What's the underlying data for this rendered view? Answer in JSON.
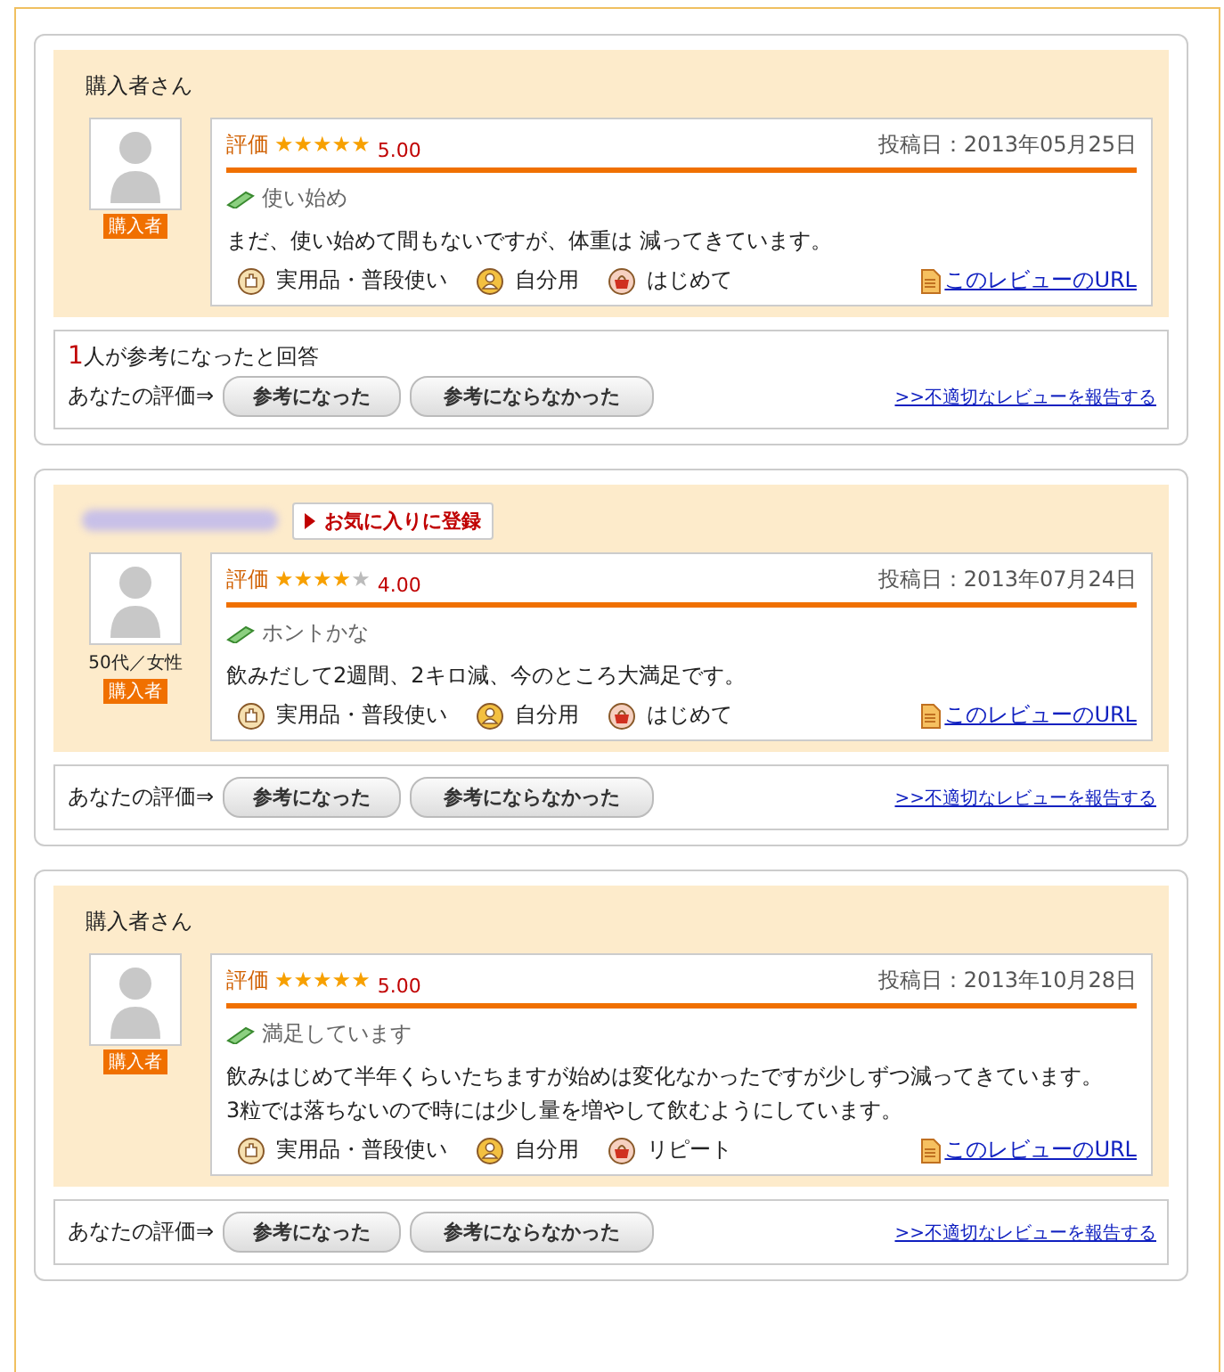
{
  "reviews": [
    {
      "reviewer": {
        "name": "購入者さん",
        "badge": "購入者"
      },
      "rating_label": "評価",
      "stars": 5,
      "score": "5.00",
      "date": "投稿日：2013年05月25日",
      "title": "使い始め",
      "body": [
        "まだ、使い始めて間もないですが、体重は 減ってきています。"
      ],
      "tags": [
        {
          "kind": "usage",
          "label": "実用品・普段使い"
        },
        {
          "kind": "recipient",
          "label": "自分用"
        },
        {
          "kind": "purchase",
          "label": "はじめて"
        }
      ],
      "url_link": "このレビューのURL",
      "helpful": {
        "count": "1",
        "text": "人が参考になったと回答"
      },
      "vote_label": "あなたの評価⇒",
      "vote_buttons": [
        "参考になった",
        "参考にならなかった"
      ],
      "report_link": ">>不適切なレビューを報告する"
    },
    {
      "reviewer": {
        "favorite_button": "お気に入りに登録",
        "profile": "50代／女性",
        "badge": "購入者"
      },
      "rating_label": "評価",
      "stars": 4,
      "score": "4.00",
      "date": "投稿日：2013年07月24日",
      "title": "ホントかな",
      "body": [
        "飲みだして2週間、2キロ減、今のところ大満足です。"
      ],
      "tags": [
        {
          "kind": "usage",
          "label": "実用品・普段使い"
        },
        {
          "kind": "recipient",
          "label": "自分用"
        },
        {
          "kind": "purchase",
          "label": "はじめて"
        }
      ],
      "url_link": "このレビューのURL",
      "vote_label": "あなたの評価⇒",
      "vote_buttons": [
        "参考になった",
        "参考にならなかった"
      ],
      "report_link": ">>不適切なレビューを報告する"
    },
    {
      "reviewer": {
        "name": "購入者さん",
        "badge": "購入者"
      },
      "rating_label": "評価",
      "stars": 5,
      "score": "5.00",
      "date": "投稿日：2013年10月28日",
      "title": "満足しています",
      "body": [
        "飲みはじめて半年くらいたちますが始めは変化なかったですが少しずつ減ってきています。",
        "3粒では落ちないので時には少し量を増やして飲むようにしています。"
      ],
      "tags": [
        {
          "kind": "usage",
          "label": "実用品・普段使い"
        },
        {
          "kind": "recipient",
          "label": "自分用"
        },
        {
          "kind": "purchase",
          "label": "リピート"
        }
      ],
      "url_link": "このレビューのURL",
      "vote_label": "あなたの評価⇒",
      "vote_buttons": [
        "参考になった",
        "参考にならなかった"
      ],
      "report_link": ">>不適切なレビューを報告する"
    }
  ]
}
